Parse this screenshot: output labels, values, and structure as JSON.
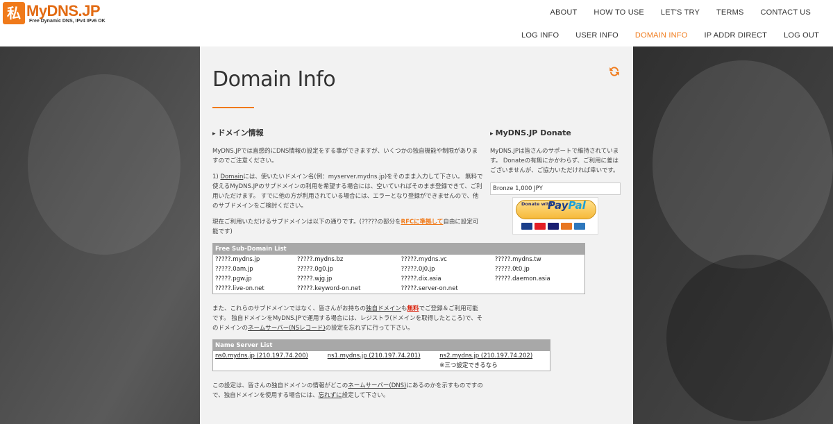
{
  "logo": {
    "badge": "私",
    "title": "MyDNS.JP",
    "subtitle": "Free Dynamic DNS, IPv4 IPv6 OK"
  },
  "nav_top": [
    "ABOUT",
    "HOW TO USE",
    "LET'S TRY",
    "TERMS",
    "CONTACT US"
  ],
  "nav_bottom": [
    "LOG INFO",
    "USER INFO",
    "DOMAIN INFO",
    "IP ADDR DIRECT",
    "LOG OUT"
  ],
  "active_nav": "DOMAIN INFO",
  "page": {
    "title": "Domain Info"
  },
  "domain_section": {
    "heading": "ドメイン情報",
    "para1": "MyDNS.JPでは直感的にDNS情報の設定をする事ができますが、いくつかの独自機能や制限がありますのでご注意ください。",
    "para2_prefix": "1) ",
    "para2_link": "Domain",
    "para2_rest": "には、使いたいドメイン名(例：myserver.mydns.jp)をそのまま入力して下さい。 無料で使えるMyDNS.JPのサブドメインの利用を希望する場合には、空いていればそのまま登録できて、ご利用いただけます。 すでに他の方が利用されている場合には、エラーとなり登録ができませんので、他のサブドメインをご検討ください。",
    "para3_prefix": "現在ご利用いただけるサブドメインは以下の通りです。(?????の部分を",
    "para3_link": "RFCに準拠して",
    "para3_suffix": "自由に設定可能です)",
    "para4_a": "また、これらのサブドメインではなく、皆さんがお持ちの",
    "para4_link1": "独自ドメイン",
    "para4_b": "も",
    "para4_link2": "無料",
    "para4_c": "でご登録＆ご利用可能です。 独自ドメインをMyDNS.JPで運用する場合には、レジストラ(ドメインを取得したところ)で、そのドメインの",
    "para4_link3": "ネームサーバー(NSレコード)",
    "para4_d": "の設定を忘れずに行って下さい。",
    "para5_a": "この設定は、皆さんの独自ドメインの情報がどこの",
    "para5_link1": "ネームサーバー(DNS)",
    "para5_b": "にあるのかを示すものですので、独自ドメインを使用する場合には、",
    "para5_link2": "忘れずに",
    "para5_c": "設定して下さい。"
  },
  "sub_domain_table": {
    "header": "Free Sub-Domain List",
    "rows": [
      [
        "?????.mydns.jp",
        "?????.mydns.bz",
        "?????.mydns.vc",
        "?????.mydns.tw"
      ],
      [
        "?????.0am.jp",
        "?????.0g0.jp",
        "?????.0j0.jp",
        "?????.0t0.jp"
      ],
      [
        "?????.pgw.jp",
        "?????.wjg.jp",
        "?????.dix.asia",
        "?????.daemon.asia"
      ],
      [
        "?????.live-on.net",
        "?????.keyword-on.net",
        "?????.server-on.net",
        ""
      ]
    ]
  },
  "name_server_table": {
    "header": "Name Server List",
    "servers": [
      "ns0.mydns.jp (210.197.74.200)",
      "ns1.mydns.jp (210.197.74.201)",
      "ns2.mydns.jp (210.197.74.202)"
    ],
    "note": "※三つ設定できるなら"
  },
  "donate": {
    "heading": "MyDNS.JP Donate",
    "text": "MyDNS.JPは皆さんのサポートで維持されています。 Donateの有無にかかわらず、ご利用に差はございませんが、ご協力いただければ幸いです。",
    "selected_option": "Bronze 1,000 JPY",
    "paypal_small": "Donate with",
    "paypal_pay": "Pay",
    "paypal_pal": "Pal"
  },
  "colors": {
    "accent": "#f07a1a",
    "red_link": "#d9200a",
    "panel_bg": "#f2f2f2"
  },
  "icons": {
    "refresh": "refresh-icon"
  }
}
